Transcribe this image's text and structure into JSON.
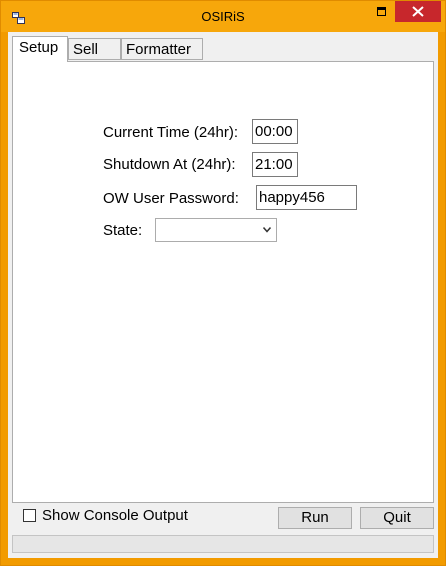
{
  "window": {
    "title": "OSIRiS"
  },
  "tabs": [
    {
      "label": "Setup",
      "active": true
    },
    {
      "label": "Sell",
      "active": false
    },
    {
      "label": "Formatter",
      "active": false
    }
  ],
  "setup": {
    "current_time_label": "Current Time (24hr):",
    "current_time_value": "00:00",
    "shutdown_label": "Shutdown At (24hr):",
    "shutdown_value": "21:00",
    "password_label": "OW User Password:",
    "password_value": "happy456",
    "state_label": "State:",
    "state_value": ""
  },
  "footer": {
    "console_label": "Show Console Output",
    "console_checked": false,
    "run_label": "Run",
    "quit_label": "Quit"
  },
  "colors": {
    "titlebar": "#f7a70b",
    "close": "#c7272c"
  }
}
